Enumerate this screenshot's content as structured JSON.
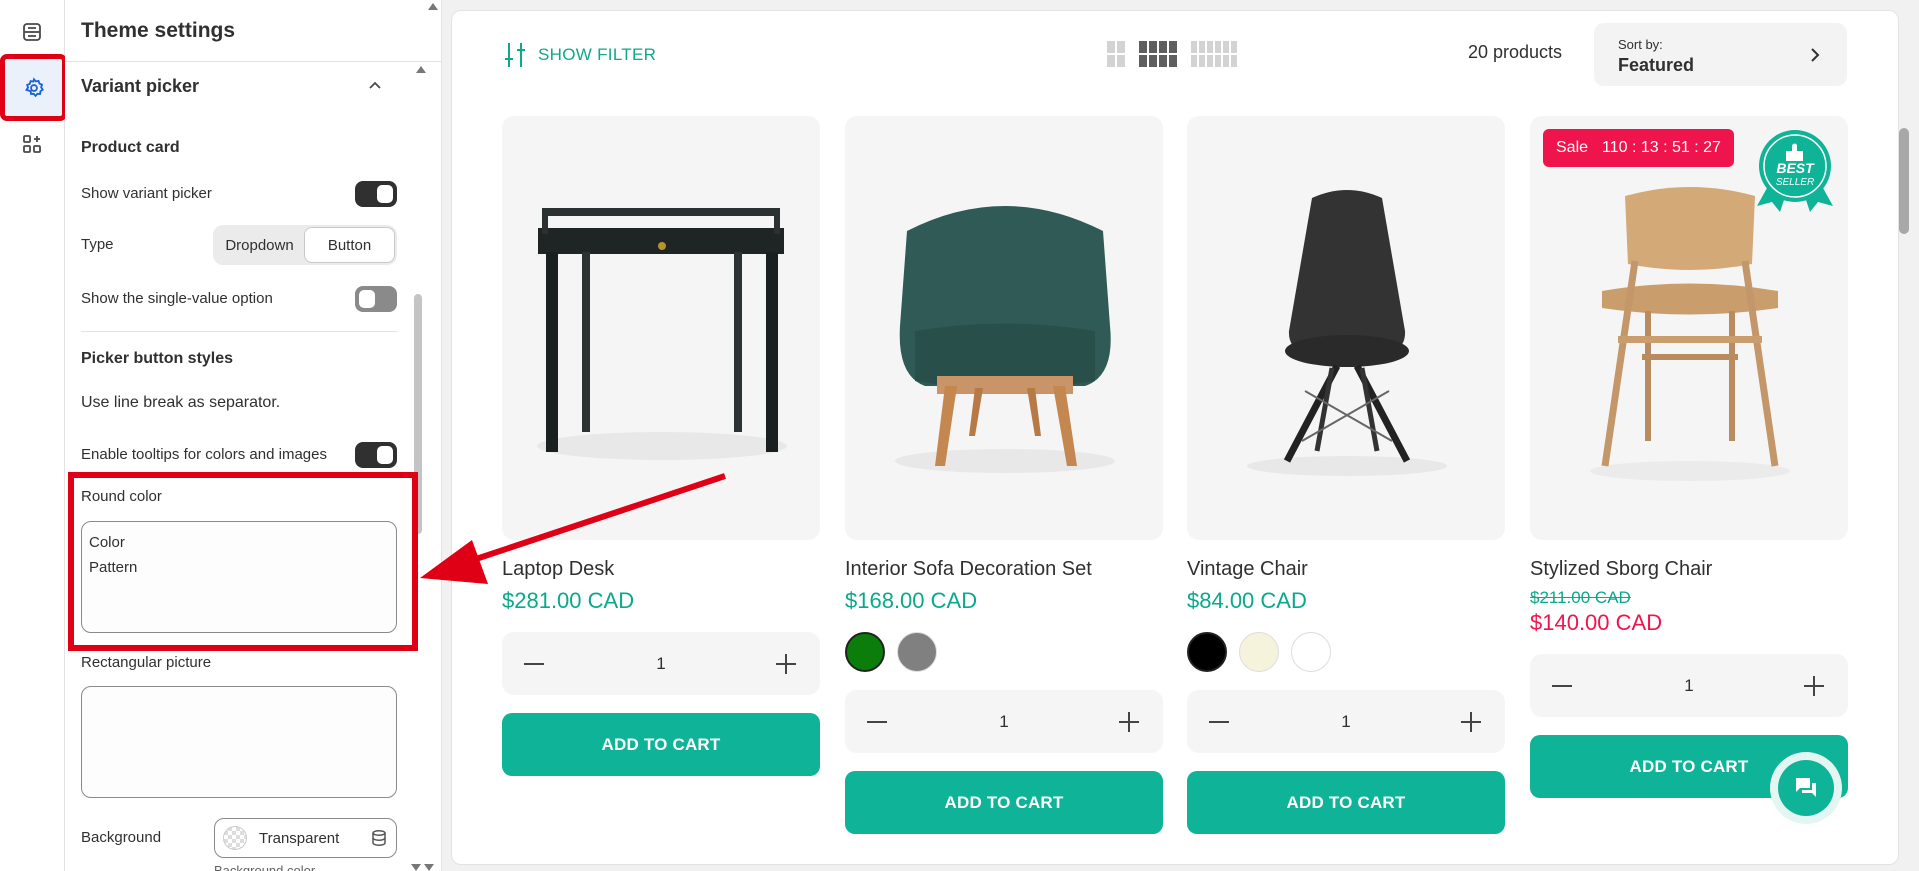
{
  "rail": {
    "items": [
      {
        "icon": "sections-icon"
      },
      {
        "icon": "gear-icon"
      },
      {
        "icon": "apps-icon"
      }
    ]
  },
  "panel": {
    "title": "Theme settings",
    "section": "Variant picker",
    "product_card": {
      "heading": "Product card",
      "show_variant_picker_label": "Show variant picker",
      "show_variant_picker_on": true,
      "type_label": "Type",
      "type_options": [
        "Dropdown",
        "Button"
      ],
      "type_selected": "Button",
      "single_value_label": "Show the single-value option",
      "single_value_on": false
    },
    "picker_styles": {
      "heading": "Picker button styles",
      "help": "Use line break as separator.",
      "tooltips_label": "Enable tooltips for colors and images",
      "tooltips_on": true,
      "round_color_label": "Round color",
      "round_color_value": "Color\nPattern",
      "rect_picture_label": "Rectangular picture",
      "rect_picture_value": "",
      "background_label": "Background",
      "background_value": "Transparent",
      "background_color_label": "Background color"
    }
  },
  "toolbar": {
    "show_filter": "SHOW FILTER",
    "count": "20 products",
    "sort_label": "Sort by:",
    "sort_value": "Featured"
  },
  "products": [
    {
      "title": "Laptop Desk",
      "price": "$281.00 CAD",
      "qty": "1",
      "add": "ADD TO CART"
    },
    {
      "title": "Interior Sofa Decoration Set",
      "price": "$168.00 CAD",
      "swatches": [
        "#0a7d0a",
        "#808080"
      ],
      "qty": "1",
      "add": "ADD TO CART"
    },
    {
      "title": "Vintage Chair",
      "price": "$84.00 CAD",
      "swatches": [
        "#000000",
        "#f5f3dc",
        "#ffffff"
      ],
      "qty": "1",
      "add": "ADD TO CART"
    },
    {
      "title": "Stylized Sborg Chair",
      "compare_price": "$211.00 CAD",
      "price": "$140.00 CAD",
      "sale_label": "Sale",
      "countdown": "110 : 13 : 51 : 27",
      "badge_line1": "BEST",
      "badge_line2": "SELLER",
      "qty": "1",
      "add": "ADD TO CART"
    }
  ],
  "colors": {
    "accent": "#0fb397",
    "sale": "#f0144d",
    "annotation": "#e00016"
  }
}
